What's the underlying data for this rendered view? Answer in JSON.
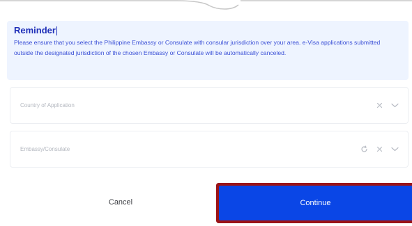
{
  "reminder": {
    "title": "Reminder",
    "body": "Please ensure that you select the Philippine Embassy or Consulate with consular jurisdiction over your area. e-Visa applications submitted outside the designated jurisdiction of the chosen Embassy or Consulate will be automatically canceled."
  },
  "country_field": {
    "placeholder": "Country of Application",
    "icons": [
      "clear-icon",
      "chevron-down-icon"
    ]
  },
  "embassy_field": {
    "placeholder": "Embassy/Consulate",
    "icons": [
      "refresh-icon",
      "clear-icon",
      "chevron-down-icon"
    ]
  },
  "actions": {
    "cancel_label": "Cancel",
    "continue_label": "Continue"
  },
  "colors": {
    "accent": "#0a46e6",
    "reminder_bg": "#eef4ff",
    "reminder_text": "#3a4fd6",
    "highlight_border": "#9b1418"
  }
}
